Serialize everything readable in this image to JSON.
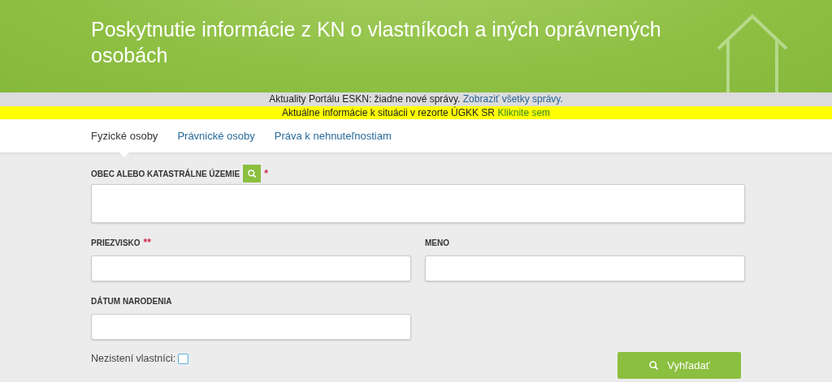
{
  "header": {
    "title": "Poskytnutie informácie z KN o vlastníkoch a iných oprávnených osobách"
  },
  "notices": [
    {
      "kind": "news",
      "text": "Aktuality Portálu ESKN: žiadne nové správy.",
      "link": "Zobraziť všetky správy."
    },
    {
      "kind": "alert",
      "text": "Aktuálne informácie k situácii v rezorte ÚGKK SR",
      "link": "Kliknite sem"
    }
  ],
  "tabs": [
    {
      "label": "Fyzické osoby",
      "selected": true
    },
    {
      "label": "Právnické osoby",
      "selected": false
    },
    {
      "label": "Práva k nehnuteľnostiam",
      "selected": false
    }
  ],
  "form": {
    "territory": {
      "label": "OBEC ALEBO KATASTRÁLNE ÚZEMIE",
      "required_mark": "*"
    },
    "surname": {
      "label": "PRIEZVISKO",
      "required_mark": "**"
    },
    "name": {
      "label": "MENO"
    },
    "birth_date": {
      "label": "DÁTUM NARODENIA"
    },
    "unknown_owners": {
      "label": "Nezistení vlastníci:",
      "checked": false
    },
    "search_button": "Vyhľadať"
  }
}
